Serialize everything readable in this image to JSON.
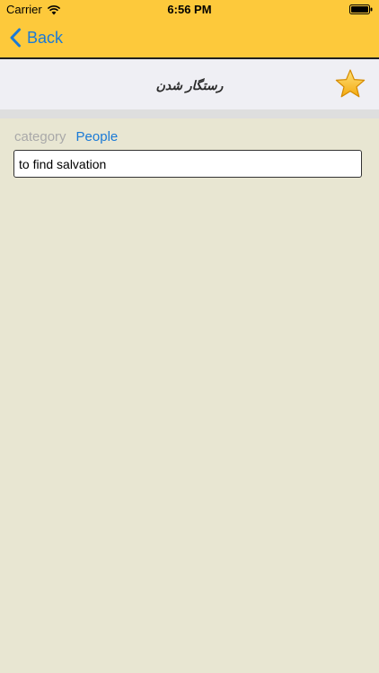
{
  "status_bar": {
    "carrier": "Carrier",
    "time": "6:56 PM",
    "icons": [
      "wifi-icon",
      "battery-icon"
    ]
  },
  "nav": {
    "back_label": "Back",
    "icons": [
      "chevron-left-icon"
    ]
  },
  "header": {
    "title": "رستگار شدن",
    "icons": [
      "star-icon"
    ]
  },
  "entry": {
    "category_label": "category",
    "category_value": "People",
    "translation": "to find salvation"
  },
  "colors": {
    "nav_background": "#fdc93b",
    "accent_blue": "#1a7ad6",
    "page_background": "#e8e6d2",
    "title_background": "#efeff4",
    "star": "#f6b417"
  }
}
